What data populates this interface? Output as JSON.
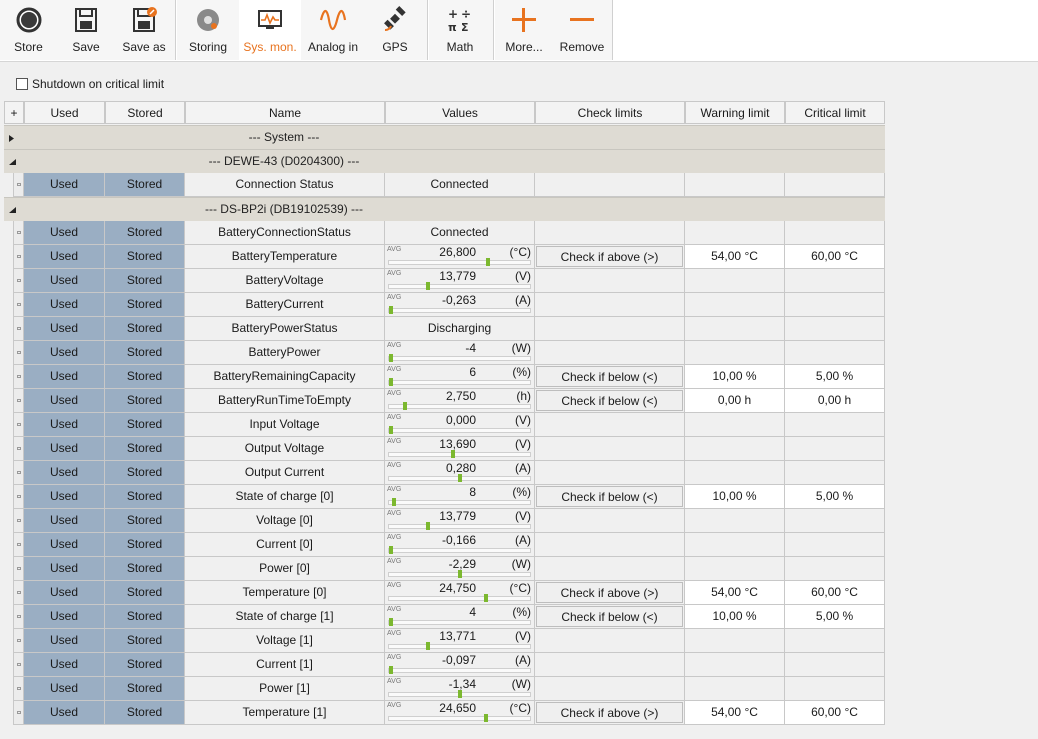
{
  "toolbar": {
    "store_label": "Store",
    "save_label": "Save",
    "saveas_label": "Save as",
    "storing_label": "Storing",
    "sysmon_label": "Sys. mon.",
    "analog_label": "Analog in",
    "gps_label": "GPS",
    "math_label": "Math",
    "more_label": "More...",
    "remove_label": "Remove",
    "accent_color": "#e8731f"
  },
  "shutdown": {
    "label": "Shutdown on critical limit",
    "checked": false
  },
  "table": {
    "headers": {
      "add": "+",
      "used": "Used",
      "stored": "Stored",
      "name": "Name",
      "values": "Values",
      "check": "Check limits",
      "warning": "Warning limit",
      "critical": "Critical limit"
    },
    "group_system": "--- System ---",
    "group_dewe": "--- DEWE-43 (D0204300) ---",
    "group_dsbp": "--- DS-BP2i (DB19102539) ---",
    "used_label": "Used",
    "stored_label": "Stored",
    "avg_label": "AVG",
    "dewe_row": {
      "name": "Connection Status",
      "value": "Connected"
    },
    "rows": [
      {
        "name": "BatteryConnectionStatus",
        "text": "Connected"
      },
      {
        "name": "BatteryTemperature",
        "value": "26,800",
        "unit": "(°C)",
        "level": 0.7,
        "check": "Check if above (>)",
        "warn": "54,00 °C",
        "crit": "60,00 °C"
      },
      {
        "name": "BatteryVoltage",
        "value": "13,779",
        "unit": "(V)",
        "level": 0.27
      },
      {
        "name": "BatteryCurrent",
        "value": "-0,263",
        "unit": "(A)",
        "level": 0.0
      },
      {
        "name": "BatteryPowerStatus",
        "text": "Discharging"
      },
      {
        "name": "BatteryPower",
        "value": "-4",
        "unit": "(W)",
        "level": 0.0
      },
      {
        "name": "BatteryRemainingCapacity",
        "value": "6",
        "unit": "(%)",
        "level": 0.0,
        "check": "Check if below (<)",
        "warn": "10,00 %",
        "crit": "5,00 %"
      },
      {
        "name": "BatteryRunTimeToEmpty",
        "value": "2,750",
        "unit": "(h)",
        "level": 0.1,
        "check": "Check if below (<)",
        "warn": "0,00 h",
        "crit": "0,00 h"
      },
      {
        "name": "Input Voltage",
        "value": "0,000",
        "unit": "(V)",
        "level": 0.0
      },
      {
        "name": "Output Voltage",
        "value": "13,690",
        "unit": "(V)",
        "level": 0.45
      },
      {
        "name": "Output Current",
        "value": "0,280",
        "unit": "(A)",
        "level": 0.5
      },
      {
        "name": "State of charge [0]",
        "value": "8",
        "unit": "(%)",
        "level": 0.02,
        "check": "Check if below (<)",
        "warn": "10,00 %",
        "crit": "5,00 %"
      },
      {
        "name": "Voltage [0]",
        "value": "13,779",
        "unit": "(V)",
        "level": 0.27
      },
      {
        "name": "Current [0]",
        "value": "-0,166",
        "unit": "(A)",
        "level": 0.0
      },
      {
        "name": "Power [0]",
        "value": "-2,29",
        "unit": "(W)",
        "level": 0.5
      },
      {
        "name": "Temperature [0]",
        "value": "24,750",
        "unit": "(°C)",
        "level": 0.69,
        "check": "Check if above (>)",
        "warn": "54,00 °C",
        "crit": "60,00 °C"
      },
      {
        "name": "State of charge [1]",
        "value": "4",
        "unit": "(%)",
        "level": 0.0,
        "check": "Check if below (<)",
        "warn": "10,00 %",
        "crit": "5,00 %"
      },
      {
        "name": "Voltage [1]",
        "value": "13,771",
        "unit": "(V)",
        "level": 0.27
      },
      {
        "name": "Current [1]",
        "value": "-0,097",
        "unit": "(A)",
        "level": 0.0
      },
      {
        "name": "Power [1]",
        "value": "-1,34",
        "unit": "(W)",
        "level": 0.5
      },
      {
        "name": "Temperature [1]",
        "value": "24,650",
        "unit": "(°C)",
        "level": 0.69,
        "check": "Check if above (>)",
        "warn": "54,00 °C",
        "crit": "60,00 °C"
      }
    ]
  }
}
